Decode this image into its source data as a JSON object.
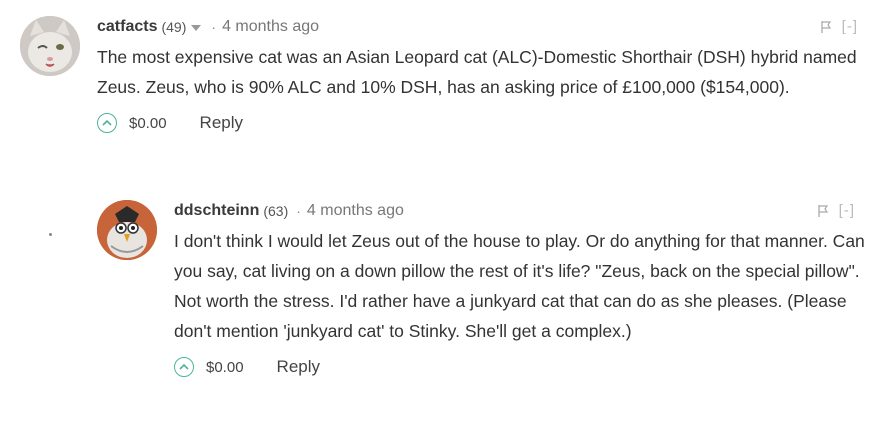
{
  "comments": [
    {
      "username": "catfacts",
      "reputation": "(49)",
      "time": "4 months ago",
      "collapse": "[-]",
      "text": "The most expensive cat was an Asian Leopard cat (ALC)-Domestic Shorthair (DSH) hybrid named Zeus. Zeus, who is 90% ALC and 10% DSH, has an asking price of £100,000 ($154,000).",
      "amount": "$0.00",
      "reply": "Reply",
      "separator": "·"
    },
    {
      "username": "ddschteinn",
      "reputation": "(63)",
      "time": "4 months ago",
      "collapse": "[-]",
      "text": "I don't think I would let Zeus out of the house to play. Or do anything for that manner. Can you say, cat living on a down pillow the rest of it's life? \"Zeus, back on the special pillow\". Not worth the stress. I'd rather have a junkyard cat that can do as she pleases. (Please don't mention 'junkyard cat' to Stinky. She'll get a complex.)",
      "amount": "$0.00",
      "reply": "Reply",
      "separator": "·"
    }
  ],
  "colors": {
    "vote_accent": "#4db39a",
    "text": "#333333"
  },
  "icons": [
    "flag-icon",
    "upvote-icon",
    "dropdown-caret-icon"
  ]
}
